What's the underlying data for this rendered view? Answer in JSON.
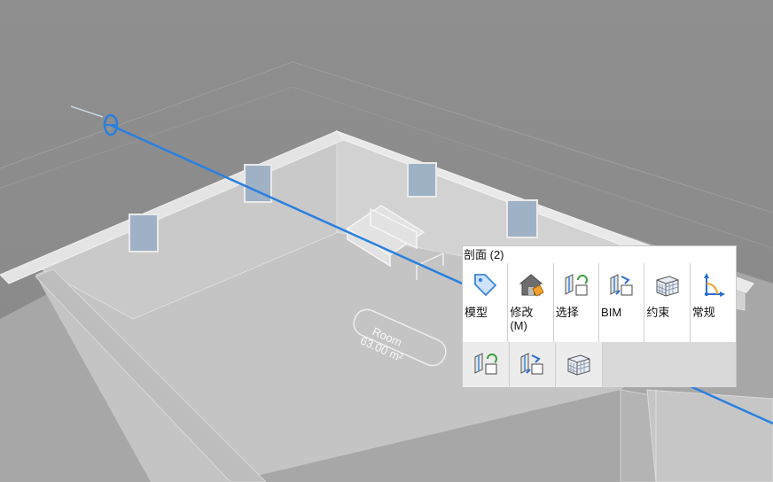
{
  "viewport": {
    "room_name": "Room",
    "room_area": "63.00 m²"
  },
  "quad_menu": {
    "title": "剖面 (2)",
    "tabs": [
      {
        "label": "模型",
        "icon": "tag-icon"
      },
      {
        "label": "修改\n(M)",
        "icon": "house-modify-icon"
      },
      {
        "label": "选择",
        "icon": "section-select-icon"
      },
      {
        "label": "BIM",
        "icon": "section-bim-icon"
      },
      {
        "label": "约束",
        "icon": "grid-box-icon"
      },
      {
        "label": "常规",
        "icon": "axis-angle-icon"
      }
    ],
    "quick_icons": [
      "section-select-icon",
      "section-bim-icon",
      "grid-box-icon"
    ]
  },
  "colors": {
    "section_line": "#2a7fe0",
    "background": "#8a8a8a"
  }
}
